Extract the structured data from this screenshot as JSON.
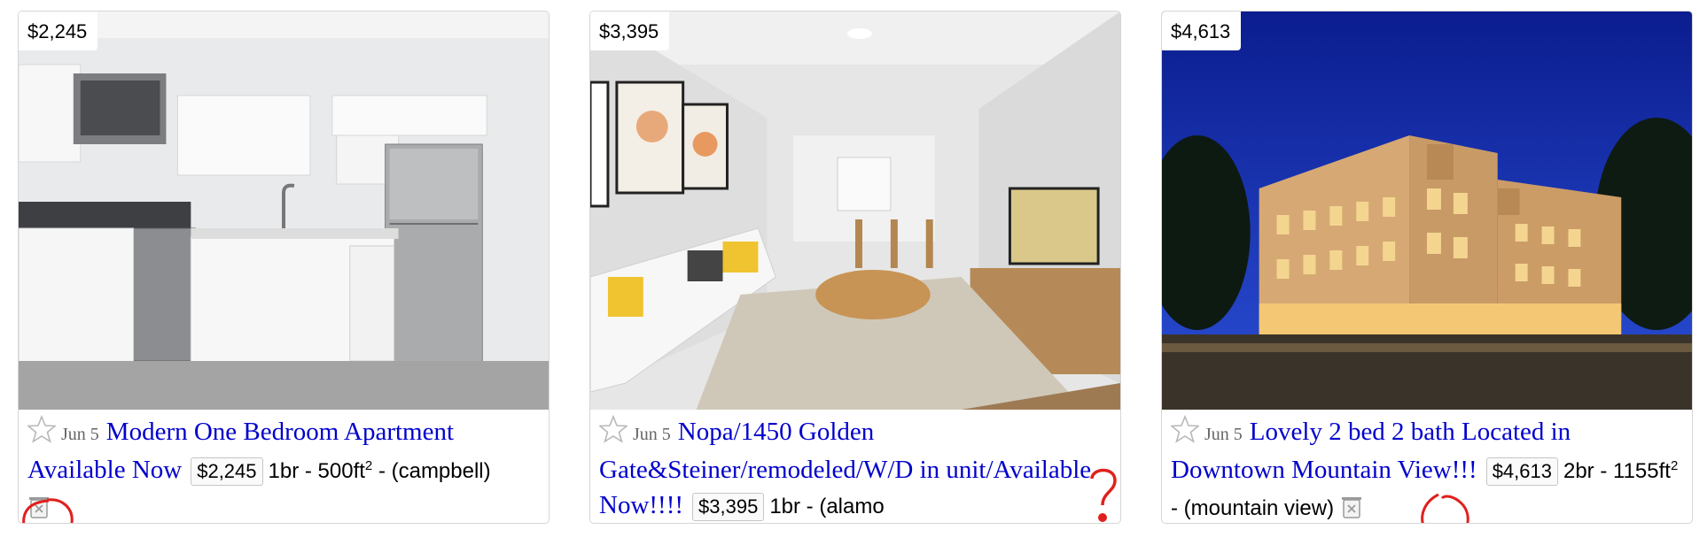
{
  "listings": [
    {
      "price_badge": "$2,245",
      "date": "Jun 5",
      "title": "Modern One Bedroom Apartment Available Now",
      "meta_price": "$2,245",
      "housing": "1br - 500ft",
      "housing_sup": "2",
      "location": "- (campbell)",
      "photo_icon": "kitchen-photo"
    },
    {
      "price_badge": "$3,395",
      "date": "Jun 5",
      "title": "Nopa/1450 Golden Gate&Steiner/remodeled/W/D in unit/Available Now!!!!",
      "meta_price": "$3,395",
      "housing": "1br - (alamo",
      "photo_icon": "living-room-photo"
    },
    {
      "price_badge": "$4,613",
      "date": "Jun 5",
      "title": "Lovely 2 bed 2 bath Located in Downtown Mountain View!!!",
      "meta_price": "$4,613",
      "housing": "2br - 1155ft",
      "housing_sup": "2",
      "location": "- (mountain view)",
      "photo_icon": "building-night-photo"
    }
  ],
  "icons": {
    "favorite": "star-icon",
    "hide": "trash-icon"
  },
  "colors": {
    "title_link": "#0000cc",
    "annotation": "#e0201c"
  }
}
